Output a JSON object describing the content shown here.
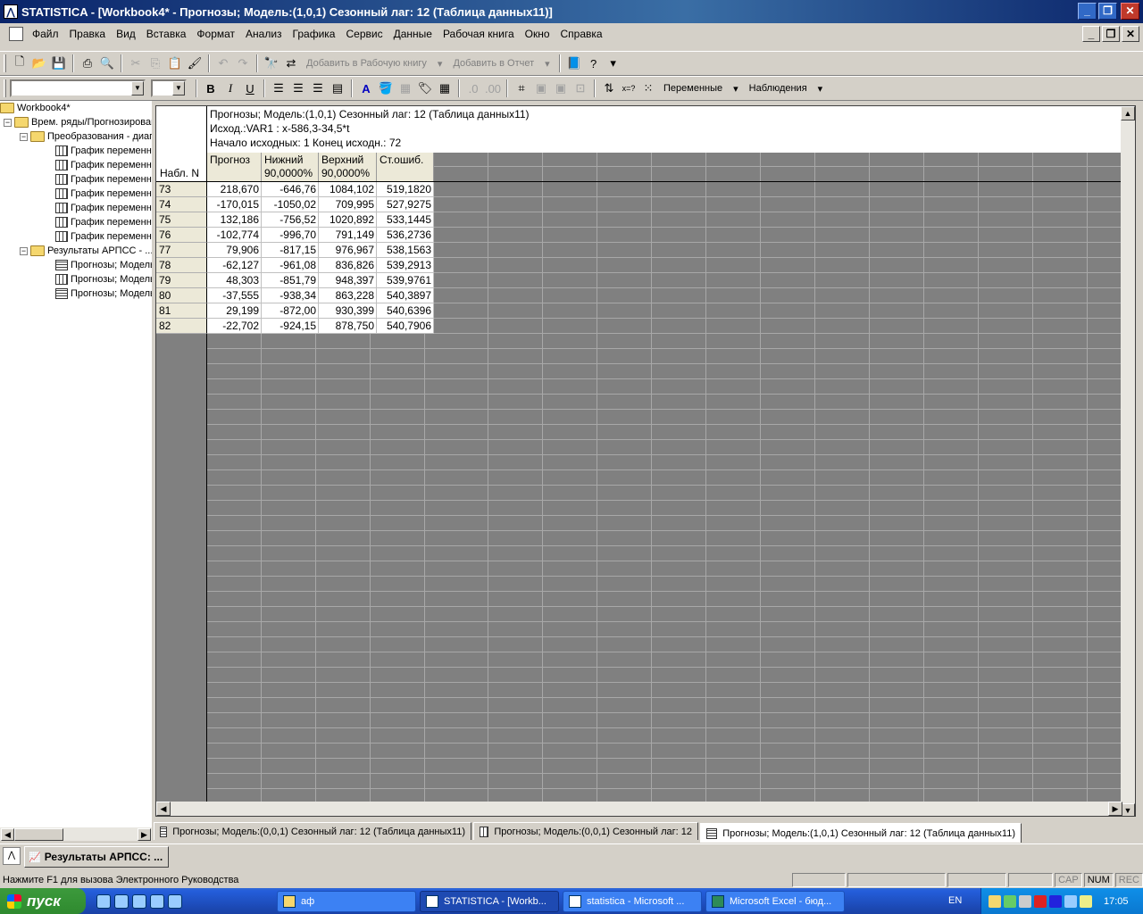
{
  "window": {
    "title": "STATISTICA - [Workbook4* - Прогнозы; Модель:(1,0,1) Сезонный лаг: 12 (Таблица данных11)]",
    "app_icon": "statistica-icon"
  },
  "menu": {
    "items": [
      "Файл",
      "Правка",
      "Вид",
      "Вставка",
      "Формат",
      "Анализ",
      "Графика",
      "Сервис",
      "Данные",
      "Рабочая книга",
      "Окно",
      "Справка"
    ]
  },
  "toolbar1": {
    "add_workbook_label": "Добавить в Рабочую книгу",
    "add_report_label": "Добавить в Отчет"
  },
  "toolbar2": {
    "variables_label": "Переменные",
    "cases_label": "Наблюдения",
    "bold": "B",
    "italic": "I",
    "underline": "U"
  },
  "tree": {
    "items": [
      {
        "label": "Workbook4*",
        "level": 0,
        "type": "folder"
      },
      {
        "label": "Врем. ряды/Прогнозирование",
        "level": 1,
        "type": "folder"
      },
      {
        "label": "Преобразования - диаграммы",
        "level": 2,
        "type": "folder"
      },
      {
        "label": "График переменной",
        "level": 3,
        "type": "graph"
      },
      {
        "label": "График переменной",
        "level": 3,
        "type": "graph"
      },
      {
        "label": "График переменной",
        "level": 3,
        "type": "graph"
      },
      {
        "label": "График переменной",
        "level": 3,
        "type": "graph"
      },
      {
        "label": "График переменной",
        "level": 3,
        "type": "graph"
      },
      {
        "label": "График переменной",
        "level": 3,
        "type": "graph"
      },
      {
        "label": "График переменной",
        "level": 3,
        "type": "graph"
      },
      {
        "label": "Результаты АРПСС - ...",
        "level": 2,
        "type": "folder"
      },
      {
        "label": "Прогнозы; Модель",
        "level": 3,
        "type": "sheet"
      },
      {
        "label": "Прогнозы; Модель",
        "level": 3,
        "type": "graph"
      },
      {
        "label": "Прогнозы; Модель",
        "level": 3,
        "type": "sheet"
      }
    ]
  },
  "sheet": {
    "info_lines": [
      "Прогнозы; Модель:(1,0,1) Сезонный лаг: 12 (Таблица данных11)",
      "Исход.:VAR1 : x-586,3-34,5*t",
      "Начало исходных: 1 Конец исходн.: 72"
    ],
    "row_header_label": "Набл. N",
    "columns": [
      {
        "line1": "Прогноз",
        "line2": ""
      },
      {
        "line1": "Нижний",
        "line2": "90,0000%"
      },
      {
        "line1": "Верхний",
        "line2": "90,0000%"
      },
      {
        "line1": "Ст.ошиб.",
        "line2": ""
      }
    ],
    "rows": [
      {
        "n": "73",
        "cells": [
          "218,670",
          "-646,76",
          "1084,102",
          "519,1820"
        ]
      },
      {
        "n": "74",
        "cells": [
          "-170,015",
          "-1050,02",
          "709,995",
          "527,9275"
        ]
      },
      {
        "n": "75",
        "cells": [
          "132,186",
          "-756,52",
          "1020,892",
          "533,1445"
        ]
      },
      {
        "n": "76",
        "cells": [
          "-102,774",
          "-996,70",
          "791,149",
          "536,2736"
        ]
      },
      {
        "n": "77",
        "cells": [
          "79,906",
          "-817,15",
          "976,967",
          "538,1563"
        ]
      },
      {
        "n": "78",
        "cells": [
          "-62,127",
          "-961,08",
          "836,826",
          "539,2913"
        ]
      },
      {
        "n": "79",
        "cells": [
          "48,303",
          "-851,79",
          "948,397",
          "539,9761"
        ]
      },
      {
        "n": "80",
        "cells": [
          "-37,555",
          "-938,34",
          "863,228",
          "540,3897"
        ]
      },
      {
        "n": "81",
        "cells": [
          "29,199",
          "-872,00",
          "930,399",
          "540,6396"
        ]
      },
      {
        "n": "82",
        "cells": [
          "-22,702",
          "-924,15",
          "878,750",
          "540,7906"
        ]
      }
    ]
  },
  "doc_tabs": [
    {
      "label": "Прогнозы; Модель:(0,0,1) Сезонный лаг: 12 (Таблица данных11)",
      "icon": "spreadsheet-icon",
      "active": false
    },
    {
      "label": "Прогнозы; Модель:(0,0,1) Сезонный лаг: 12",
      "icon": "graph-icon",
      "active": false
    },
    {
      "label": "Прогнозы; Модель:(1,0,1) Сезонный лаг: 12 (Таблица данных11)",
      "icon": "spreadsheet-icon",
      "active": true
    }
  ],
  "app_strip": {
    "result_button": "Результаты АРПСС: ..."
  },
  "status": {
    "message": "Нажмите F1 для вызова Электронного Руководства",
    "cap": "CAP",
    "num": "NUM",
    "rec": "REC"
  },
  "taskbar": {
    "start": "пуск",
    "tasks": [
      {
        "label": "аф",
        "active": false
      },
      {
        "label": "STATISTICA - [Workb...",
        "active": true
      },
      {
        "label": "statistica - Microsoft ...",
        "active": false
      },
      {
        "label": "Microsoft Excel - бюд...",
        "active": false
      }
    ],
    "lang": "EN",
    "time": "17:05"
  }
}
